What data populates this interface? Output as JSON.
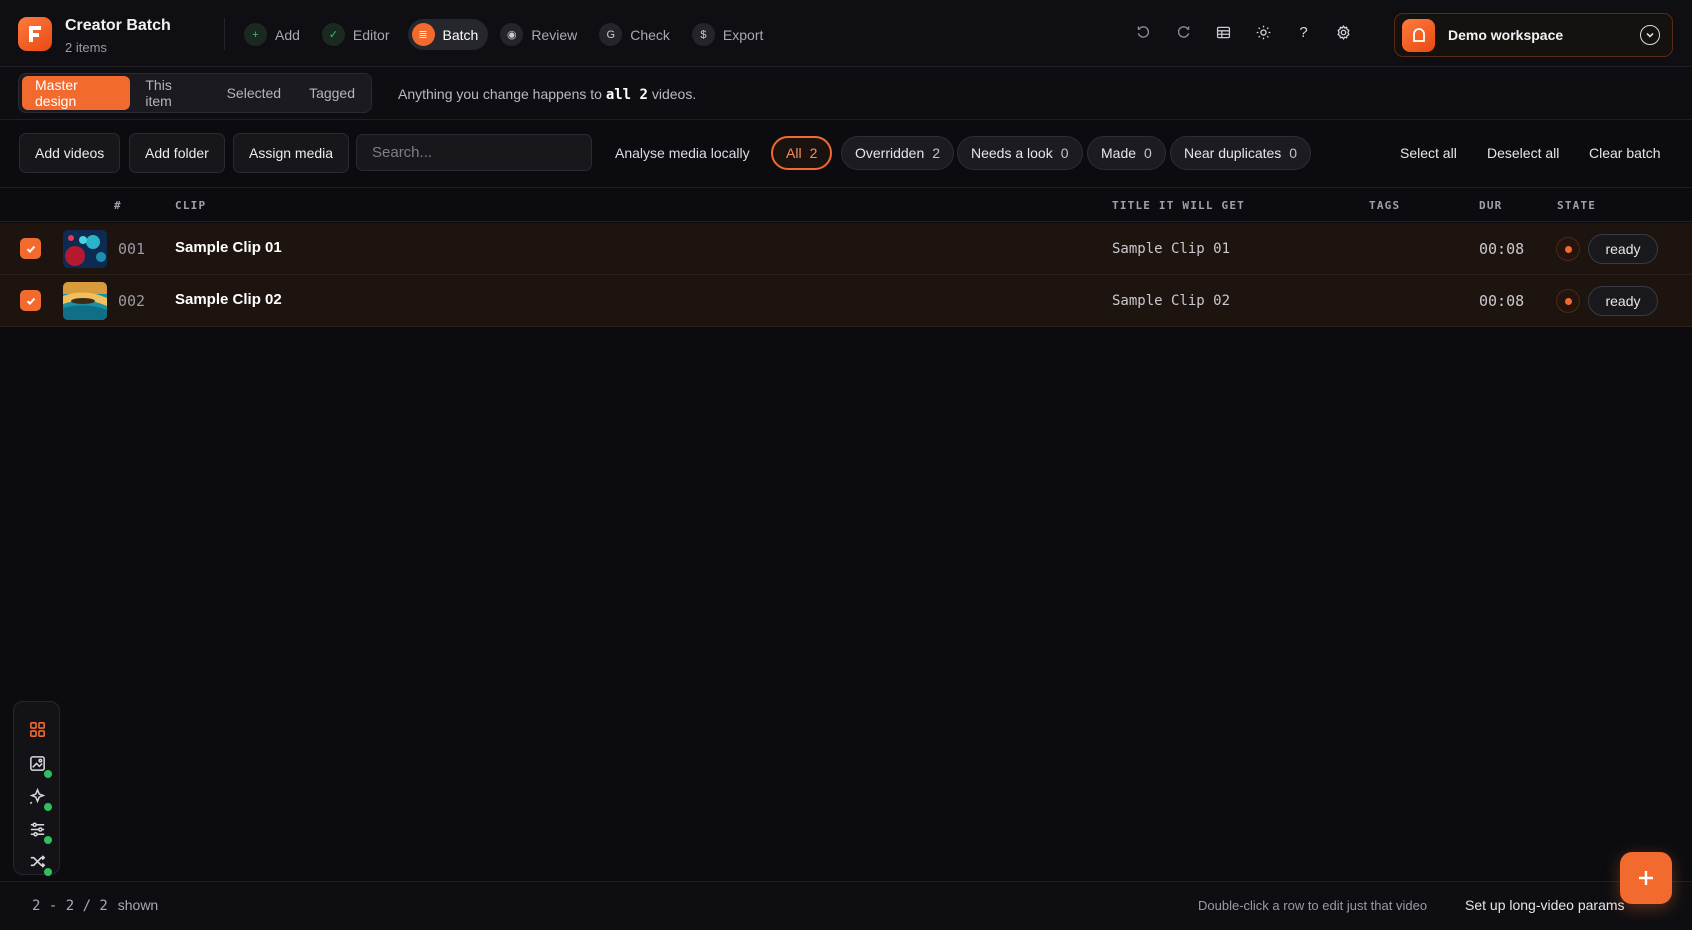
{
  "app": {
    "title": "Creator Batch",
    "subtitle": "2 items"
  },
  "steps": [
    {
      "label": "Add",
      "icon": "plus-icon",
      "state": "done"
    },
    {
      "label": "Editor",
      "icon": "check-icon",
      "state": "done"
    },
    {
      "label": "Batch",
      "icon": "list-icon",
      "state": "active"
    },
    {
      "label": "Review",
      "icon": "eye-icon",
      "state": "pending"
    },
    {
      "label": "Check",
      "icon": "check-circle-icon",
      "state": "pending"
    },
    {
      "label": "Export",
      "icon": "dollar-icon",
      "state": "pending"
    }
  ],
  "toolbar_icons": [
    "undo-icon",
    "redo-icon",
    "table-icon",
    "sun-icon",
    "help-icon",
    "gear-icon"
  ],
  "workspace": {
    "name": "Demo workspace"
  },
  "scope": {
    "tabs": [
      "Master design",
      "This item",
      "Selected",
      "Tagged"
    ],
    "active_tab": "Master design",
    "message_prefix": "Anything you change happens to",
    "message_bold": "all 2",
    "message_suffix": "videos."
  },
  "actions": {
    "add_videos": "Add videos",
    "add_folder": "Add folder",
    "assign_media": "Assign media",
    "search_placeholder": "Search...",
    "analyse": "Analyse media locally",
    "select_all": "Select all",
    "deselect_all": "Deselect all",
    "clear_batch": "Clear batch"
  },
  "filters": [
    {
      "label": "All",
      "count": "2",
      "active": true
    },
    {
      "label": "Overridden",
      "count": "2",
      "active": false
    },
    {
      "label": "Needs a look",
      "count": "0",
      "active": false
    },
    {
      "label": "Made",
      "count": "0",
      "active": false
    },
    {
      "label": "Near duplicates",
      "count": "0",
      "active": false
    }
  ],
  "table": {
    "columns": {
      "num": "#",
      "clip": "CLIP",
      "title": "TITLE IT WILL GET",
      "tags": "TAGS",
      "dur": "DUR",
      "state": "STATE"
    },
    "rows": [
      {
        "num": "001",
        "clip": "Sample Clip 01",
        "title": "Sample Clip 01",
        "tags": "",
        "dur": "00:08",
        "state": "ready",
        "checked": true
      },
      {
        "num": "002",
        "clip": "Sample Clip 02",
        "title": "Sample Clip 02",
        "tags": "",
        "dur": "00:08",
        "state": "ready",
        "checked": true
      }
    ]
  },
  "rail": [
    "grid-icon",
    "image-icon",
    "sparkle-icon",
    "sliders-icon",
    "shuffle-icon"
  ],
  "footer": {
    "count": "2 - 2 / 2",
    "count_suffix": "shown",
    "hint": "Double-click a row to edit just that video",
    "long_video": "Set up long-video params"
  },
  "colors": {
    "accent": "#f26a2e",
    "background": "#0c0c10",
    "row_selected": "#1d140f",
    "status_ok": "#2fbf5e"
  }
}
